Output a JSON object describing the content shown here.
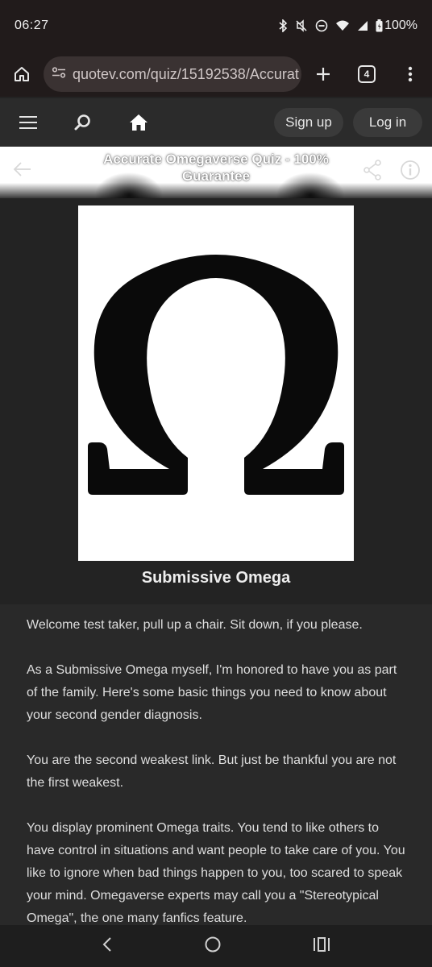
{
  "status": {
    "time": "06:27",
    "battery": "100%"
  },
  "browser": {
    "url": "quotev.com/quiz/15192538/Accurat",
    "tab_count": "4"
  },
  "nav": {
    "signup_label": "Sign up",
    "login_label": "Log in"
  },
  "quiz": {
    "title": "Accurate Omegaverse Quiz - 100% Guarantee"
  },
  "result": {
    "image_icon": "omega-symbol",
    "title": "Submissive Omega",
    "paragraphs": [
      "Welcome test taker, pull up a chair. Sit down, if you please.",
      "As a Submissive Omega myself, I'm honored to have you as part of the family. Here's some basic things you need to know about your second gender diagnosis.",
      "You are the second weakest link. But just be thankful you are not the first weakest.",
      "You display prominent Omega traits. You tend to like others to have control in situations and want people to take care of you. You like to ignore when bad things happen to you, too scared to speak your mind. Omegaverse experts may call you a \"Stereotypical Omega\", the one many fanfics feature."
    ]
  },
  "colors": {
    "status_bg": "#211b1b",
    "nav_bg": "#2b2b2b",
    "page_bg": "#232323",
    "text": "#dedede"
  }
}
